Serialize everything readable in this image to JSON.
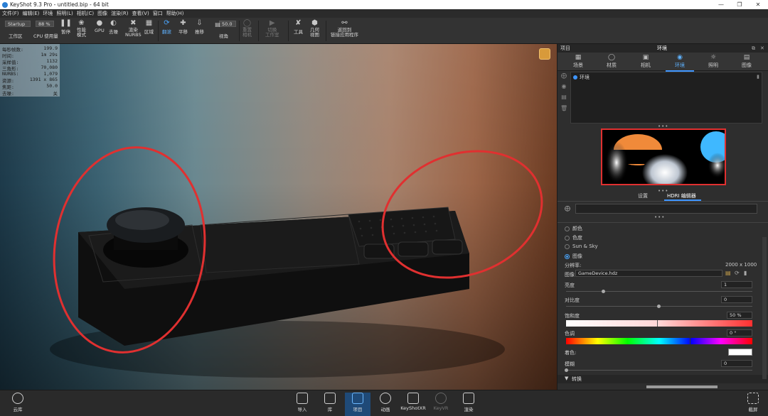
{
  "window": {
    "title": "KeyShot 9.3 Pro  -  untitled.bip  -  64 bit",
    "min_icon": "minimize-icon",
    "max_icon": "maximize-icon",
    "close_icon": "close-icon"
  },
  "menu": [
    "文件(F)",
    "编辑(E)",
    "环境",
    "照明(L)",
    "相机(C)",
    "图像",
    "渲染(R)",
    "查看(V)",
    "窗口",
    "帮助(H)"
  ],
  "toolbar": {
    "workspace_value": "Startup",
    "workspace_label": "工作区",
    "cpu_value": "88 %",
    "cpu_label": "CPU 使用量",
    "pause": "暂停",
    "performance": "性能\n模式",
    "gpu": "GPU",
    "denoise": "去噪",
    "render_nurbs": "渲染\nNURBS",
    "region": "区域",
    "tumble": "翻滚",
    "pan": "平移",
    "dolly": "推移",
    "fov_value": "50.0",
    "fov_label": "视角",
    "reset_camera": "重置\n相机",
    "switch_studio": "切换\n工作室",
    "tools": "工具",
    "geometry_view": "几何\n视图",
    "return_app": "返回到\n链接应用程序"
  },
  "stats": [
    {
      "label": "每秒帧数:",
      "value": "199.9"
    },
    {
      "label": "时间:",
      "value": "1m 29s"
    },
    {
      "label": "采样值:",
      "value": "1132"
    },
    {
      "label": "三角形:",
      "value": "70,080"
    },
    {
      "label": "NURBS:",
      "value": "1,079"
    },
    {
      "label": "资源:",
      "value": "1391 x 865"
    },
    {
      "label": "焦距:",
      "value": "50.0"
    },
    {
      "label": "去噪:",
      "value": "关"
    }
  ],
  "panel": {
    "project_label": "项目",
    "title": "环境",
    "tabs": [
      {
        "label": "场景",
        "icon": "scene-icon"
      },
      {
        "label": "材质",
        "icon": "material-icon"
      },
      {
        "label": "相机",
        "icon": "camera-icon"
      },
      {
        "label": "环境",
        "icon": "environment-icon"
      },
      {
        "label": "照明",
        "icon": "lighting-icon"
      },
      {
        "label": "图像",
        "icon": "image-icon"
      }
    ],
    "env_item": "环境",
    "subtabs": [
      "设置",
      "HDRI 编辑器"
    ],
    "background_options": [
      "颜色",
      "色度",
      "Sun & Sky",
      "图像"
    ],
    "resolution_label": "分辨率:",
    "resolution_value": "2000 x 1000",
    "image_label": "图像",
    "image_file": "GameDevice.hdz",
    "brightness_label": "亮度",
    "brightness_value": "1",
    "contrast_label": "对比度",
    "contrast_value": "0",
    "saturation_label": "饱和度",
    "saturation_value": "50 %",
    "hue_label": "色调",
    "hue_value": "0 °",
    "tint_label": "着色:",
    "blur_label": "模糊",
    "blur_value": "0",
    "transform_label": "转换"
  },
  "bottombar": {
    "cloud": "云库",
    "import": "导入",
    "library": "库",
    "project": "项目",
    "animation": "动画",
    "keyshotxr": "KeyShotXR",
    "keyvr": "KeyVR",
    "render": "渲染",
    "screenshot": "截屏"
  },
  "colors": {
    "accent": "#3e95ff",
    "annotation_red": "#e03030"
  }
}
